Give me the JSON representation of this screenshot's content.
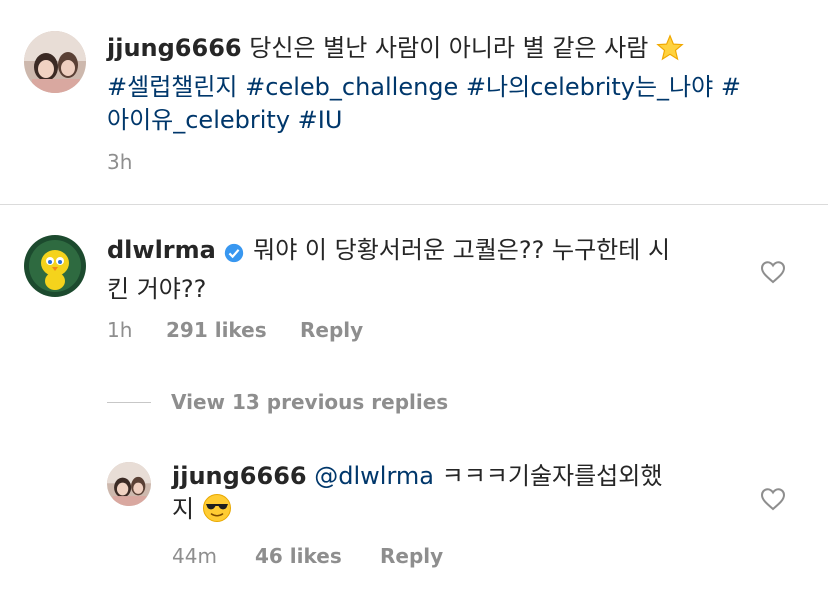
{
  "post": {
    "username": "jjung6666",
    "caption": "당신은 별난 사람이 아니라 별 같은 사람",
    "caption_emoji": "star-emoji",
    "hashtags_line1": "#셀럽챌린지 #celeb_challenge #나의celebrity는_나야 #",
    "hashtags_line2": "아이유_celebrity #IU",
    "time": "3h"
  },
  "comment": {
    "username": "dlwlrma",
    "verified_icon": "verified-badge-icon",
    "text_line1": "뭐야 이 당황서러운 고퀄은?? 누구한테 시",
    "text_line2": "킨 거야??",
    "time": "1h",
    "likes": "291 likes",
    "reply_label": "Reply"
  },
  "view_replies": {
    "label": "View 13 previous replies"
  },
  "reply": {
    "username": "jjung6666",
    "mention": "@dlwlrma",
    "text_line1": "ㅋㅋㅋ기술자를섭외했",
    "text_line2": "지",
    "emoji": "sunglasses-emoji",
    "time": "44m",
    "likes": "46 likes",
    "reply_label": "Reply"
  },
  "colors": {
    "link": "#00376b",
    "muted": "#8e8e8e",
    "verified": "#3897f0"
  }
}
